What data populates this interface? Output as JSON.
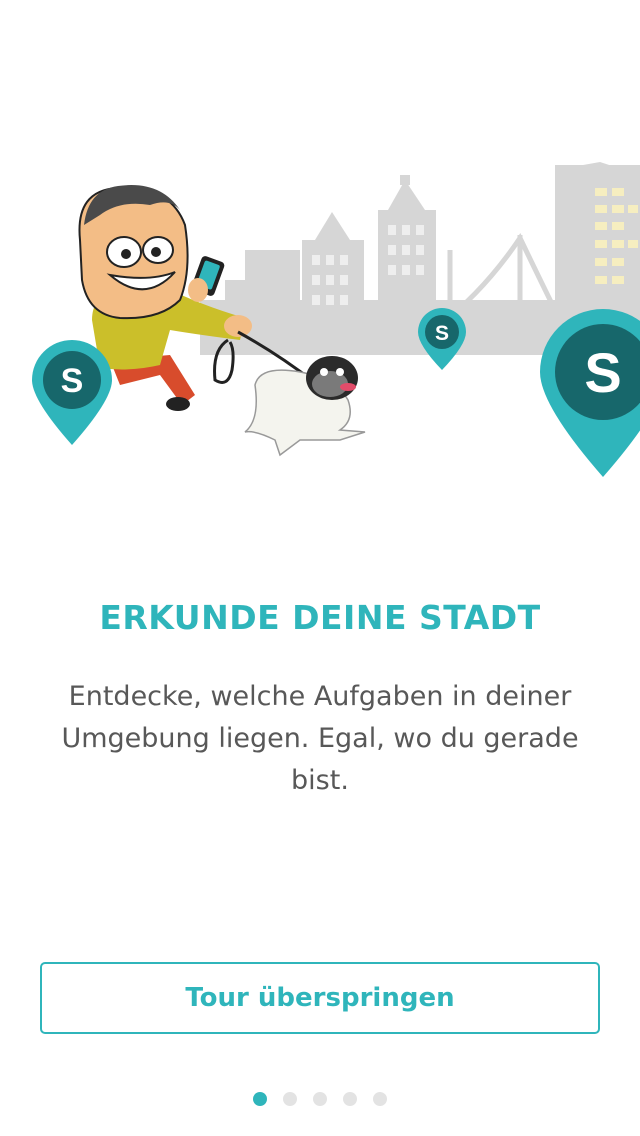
{
  "onboarding": {
    "title": "ERKUNDE DEINE STADT",
    "description": "Entdecke, welche Aufgaben in deiner Umgebung liegen. Egal, wo du gerade bist.",
    "skip_label": "Tour überspringen",
    "page_count": 5,
    "active_page": 1
  },
  "colors": {
    "accent": "#2fb5bb",
    "pin_dark": "#17676b",
    "skyline": "#d6d6d6"
  },
  "pin_letter": "S"
}
